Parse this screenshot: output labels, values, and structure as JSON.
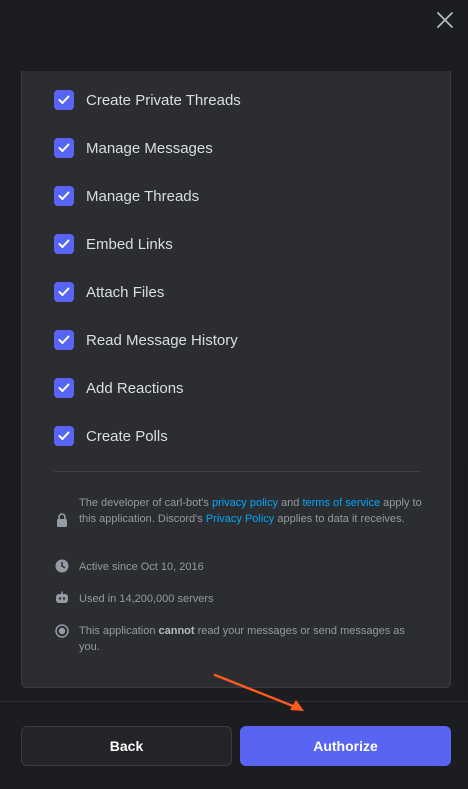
{
  "permissions": [
    {
      "label": "Create Private Threads",
      "checked": true
    },
    {
      "label": "Manage Messages",
      "checked": true
    },
    {
      "label": "Manage Threads",
      "checked": true
    },
    {
      "label": "Embed Links",
      "checked": true
    },
    {
      "label": "Attach Files",
      "checked": true
    },
    {
      "label": "Read Message History",
      "checked": true
    },
    {
      "label": "Add Reactions",
      "checked": true
    },
    {
      "label": "Create Polls",
      "checked": true
    }
  ],
  "info": {
    "policy_prefix": "The developer of carl-bot's",
    "privacy_policy_link": "privacy policy",
    "and_text": "and",
    "terms_link": "terms of service",
    "policy_middle": "apply to this application. Discord's",
    "discord_privacy_link": "Privacy Policy",
    "policy_suffix": "applies to data it receives.",
    "active_since": "Active since Oct 10, 2016",
    "used_in": "Used in 14,200,000 servers",
    "cannot_prefix": "This application",
    "cannot_bold": "cannot",
    "cannot_suffix": "read your messages or send messages as you."
  },
  "buttons": {
    "back": "Back",
    "authorize": "Authorize"
  },
  "icons": {
    "close": "close-icon",
    "lock": "lock-icon",
    "clock": "clock-icon",
    "bot": "bot-icon",
    "shield": "shield-icon",
    "check": "check-icon"
  },
  "colors": {
    "accent": "#5865f2",
    "link": "#00a8fc",
    "annotation_arrow": "#ff5a1f"
  }
}
